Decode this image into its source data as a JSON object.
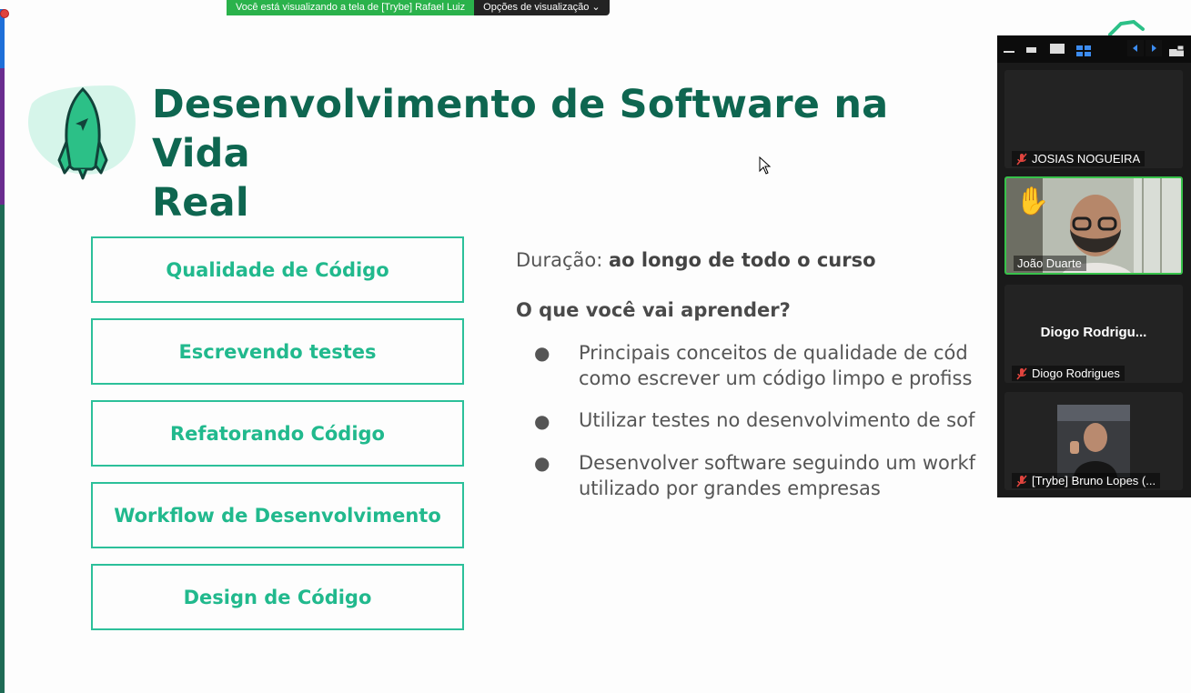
{
  "banner": {
    "viewing_text": "Você está visualizando a tela de [Trybe] Rafael Luiz",
    "options_label": "Opções de visualização"
  },
  "slide": {
    "title_line1": "Desenvolvimento de Software na Vida",
    "title_line2": "Real",
    "topics": [
      "Qualidade de Código",
      "Escrevendo testes",
      "Refatorando Código",
      "Workflow de Desenvolvimento",
      "Design de Código"
    ],
    "duration_label": "Duração:",
    "duration_value": "ao longo de todo o curso",
    "learn_title": "O que você vai aprender?",
    "bullets": [
      {
        "line1": "Principais conceitos de qualidade de cód",
        "line2": "como escrever um código limpo e profiss"
      },
      {
        "line1": "Utilizar testes no desenvolvimento de sof",
        "line2": ""
      },
      {
        "line1": "Desenvolver software seguindo um workf",
        "line2": "utilizado por grandes empresas"
      }
    ],
    "accent_color": "#21b98d",
    "title_color": "#0e6650"
  },
  "participants": [
    {
      "name": "JOSIAS NOGUEIRA",
      "muted": true
    },
    {
      "name": "João Duarte",
      "muted": false,
      "raised_hand": true,
      "active_speaker": true
    },
    {
      "name": "Diogo Rodrigues",
      "display_center": "Diogo Rodrigu...",
      "muted": true
    },
    {
      "name": "[Trybe] Bruno Lopes (...",
      "muted": true
    }
  ]
}
